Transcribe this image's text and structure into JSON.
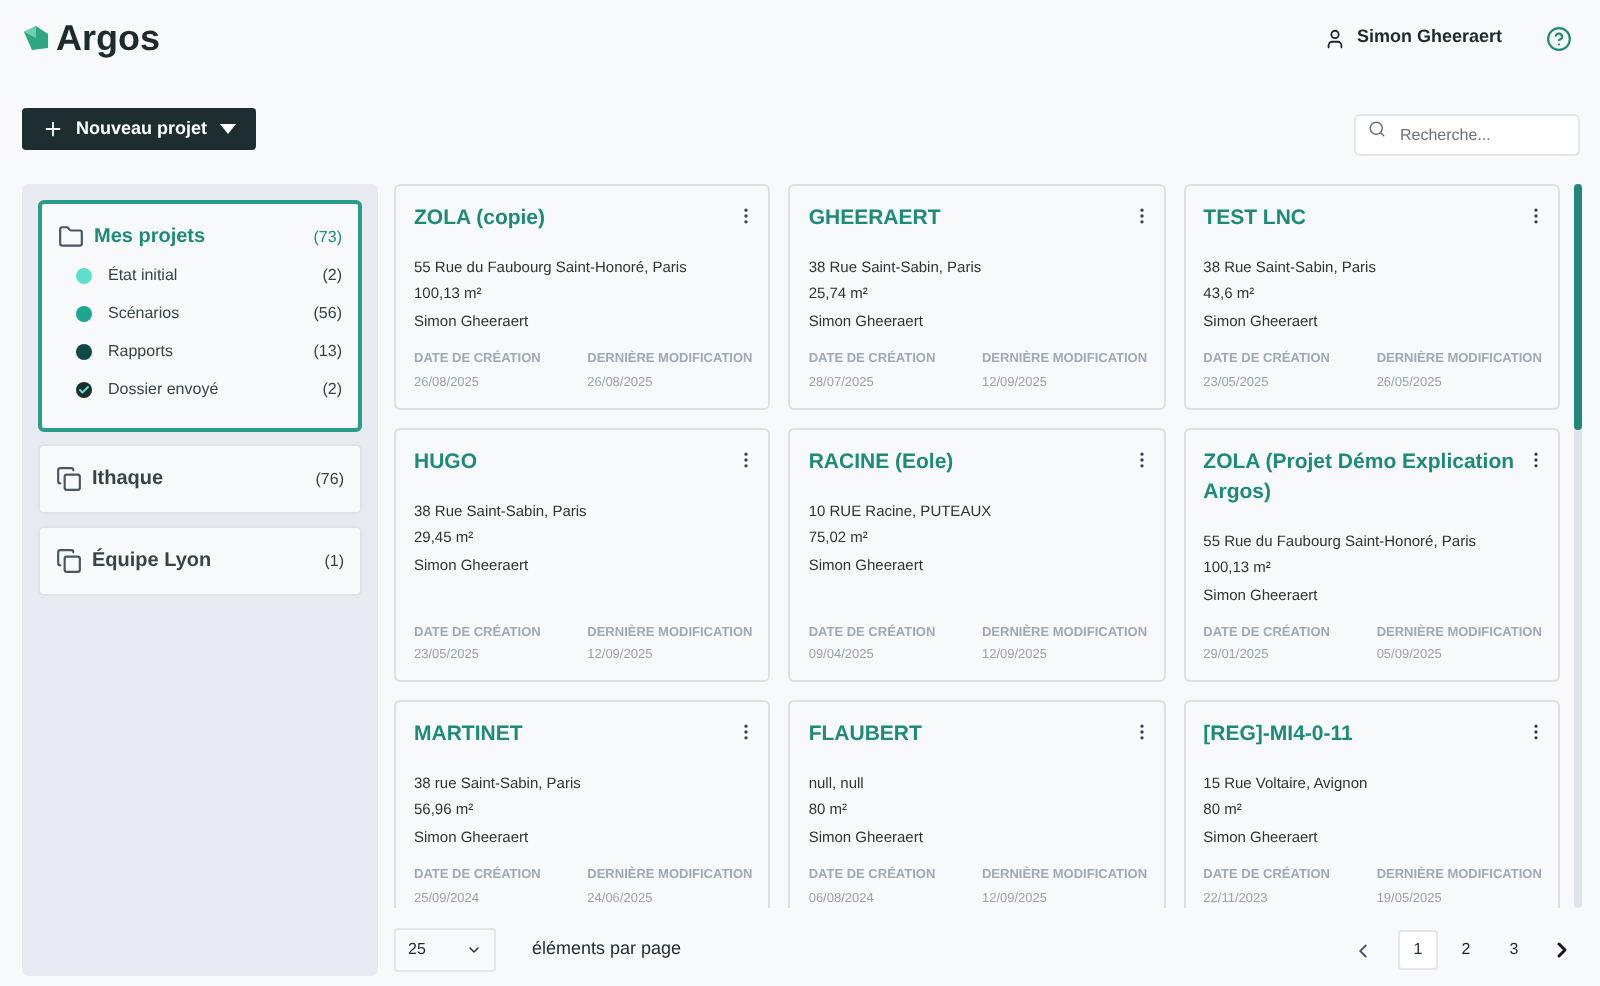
{
  "header": {
    "brand": "Argos",
    "user": "Simon Gheeraert"
  },
  "toolbar": {
    "new_button": "Nouveau projet",
    "search": {
      "placeholder": "Recherche..."
    }
  },
  "sidebar": {
    "groups": [
      {
        "label": "Mes projets",
        "count": "(73)",
        "selected": true,
        "expanded": true,
        "kind": "folder",
        "children": [
          {
            "label": "État initial",
            "count": "(2)",
            "color": "#5fe0cf",
            "kind": "dot"
          },
          {
            "label": "Scénarios",
            "count": "(56)",
            "color": "#1fa690",
            "kind": "dot"
          },
          {
            "label": "Rapports",
            "count": "(13)",
            "color": "#0f4a44",
            "kind": "dot"
          },
          {
            "label": "Dossier envoyé",
            "count": "(2)",
            "color": "#1b2e2c",
            "kind": "done"
          }
        ]
      },
      {
        "label": "Ithaque",
        "count": "(76)",
        "selected": false,
        "expanded": false,
        "kind": "shared"
      },
      {
        "label": "Équipe Lyon",
        "count": "(1)",
        "selected": false,
        "expanded": false,
        "kind": "shared"
      }
    ]
  },
  "projects": {
    "cards": [
      {
        "title": "ZOLA (copie)",
        "address": "55 Rue du Faubourg Saint-Honoré, Paris",
        "area": "100,13 m²",
        "owner": "Simon Gheeraert",
        "created_label": "DATE DE CRÉATION",
        "created": "26/08/2025",
        "modified_label": "DERNIÈRE MODIFICATION",
        "modified": "26/08/2025"
      },
      {
        "title": "GHEERAERT",
        "address": "38 Rue Saint-Sabin, Paris",
        "area": "25,74 m²",
        "owner": "Simon Gheeraert",
        "created_label": "DATE DE CRÉATION",
        "created": "28/07/2025",
        "modified_label": "DERNIÈRE MODIFICATION",
        "modified": "12/09/2025"
      },
      {
        "title": "TEST LNC",
        "address": "38 Rue Saint-Sabin, Paris",
        "area": "43,6 m²",
        "owner": "Simon Gheeraert",
        "created_label": "DATE DE CRÉATION",
        "created": "23/05/2025",
        "modified_label": "DERNIÈRE MODIFICATION",
        "modified": "26/05/2025"
      },
      {
        "title": "HUGO",
        "address": "38 Rue Saint-Sabin, Paris",
        "area": "29,45 m²",
        "owner": "Simon Gheeraert",
        "created_label": "DATE DE CRÉATION",
        "created": "23/05/2025",
        "modified_label": "DERNIÈRE MODIFICATION",
        "modified": "12/09/2025"
      },
      {
        "title": "RACINE (Eole)",
        "address": "10 RUE Racine, PUTEAUX",
        "area": "75,02 m²",
        "owner": "Simon Gheeraert",
        "created_label": "DATE DE CRÉATION",
        "created": "09/04/2025",
        "modified_label": "DERNIÈRE MODIFICATION",
        "modified": "12/09/2025"
      },
      {
        "title": "ZOLA (Projet Démo Explication Argos)",
        "address": "55 Rue du Faubourg Saint-Honoré, Paris",
        "area": "100,13 m²",
        "owner": "Simon Gheeraert",
        "created_label": "DATE DE CRÉATION",
        "created": "29/01/2025",
        "modified_label": "DERNIÈRE MODIFICATION",
        "modified": "05/09/2025"
      },
      {
        "title": "MARTINET",
        "address": "38 rue Saint-Sabin, Paris",
        "area": "56,96 m²",
        "owner": "Simon Gheeraert",
        "created_label": "DATE DE CRÉATION",
        "created": "25/09/2024",
        "modified_label": "DERNIÈRE MODIFICATION",
        "modified": "24/06/2025"
      },
      {
        "title": "FLAUBERT",
        "address": "null, null",
        "area": "80 m²",
        "owner": "Simon Gheeraert",
        "created_label": "DATE DE CRÉATION",
        "created": "06/08/2024",
        "modified_label": "DERNIÈRE MODIFICATION",
        "modified": "12/09/2025"
      },
      {
        "title": "[REG]-MI4-0-11",
        "address": "15 Rue Voltaire, Avignon",
        "area": "80 m²",
        "owner": "Simon Gheeraert",
        "created_label": "DATE DE CRÉATION",
        "created": "22/11/2023",
        "modified_label": "DERNIÈRE MODIFICATION",
        "modified": "19/05/2025"
      }
    ]
  },
  "pagination": {
    "page_size": "25",
    "page_size_label": "éléments par page",
    "pages": [
      {
        "label": "1",
        "selected": true
      },
      {
        "label": "2",
        "selected": false
      },
      {
        "label": "3",
        "selected": false
      }
    ]
  }
}
